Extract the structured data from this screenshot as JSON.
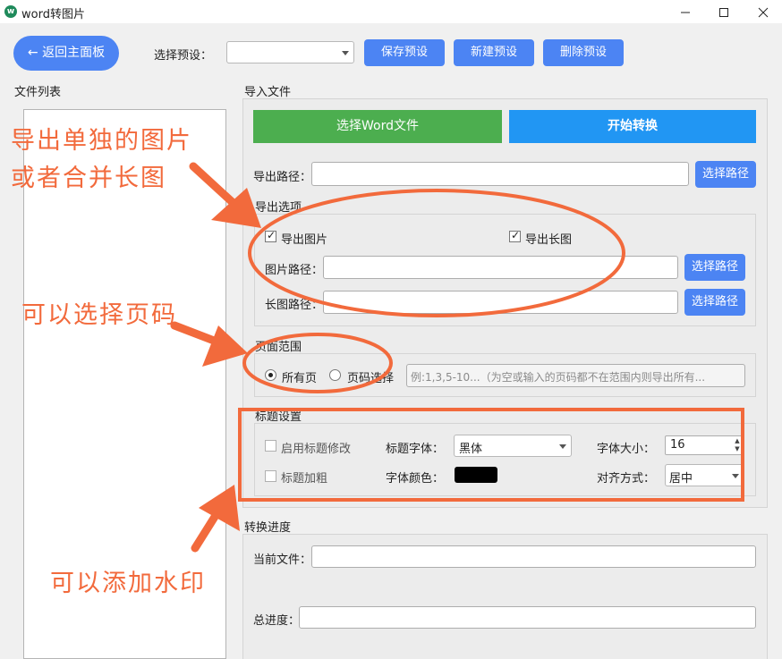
{
  "window": {
    "title": "word转图片",
    "icon": "app-logo-icon",
    "controls": [
      "minimize-icon",
      "maximize-icon",
      "close-icon"
    ]
  },
  "toolbar": {
    "back_label": "← 返回主面板",
    "preset_label": "选择预设：",
    "preset_value": "",
    "save_preset": "保存预设",
    "new_preset": "新建预设",
    "delete_preset": "删除预设"
  },
  "file_list": {
    "label": "文件列表"
  },
  "import": {
    "label": "导入文件",
    "select_word": "选择Word文件",
    "start": "开始转换",
    "export_path_label": "导出路径：",
    "export_path_value": "",
    "choose_path": "选择路径"
  },
  "export_options": {
    "label": "导出选项",
    "export_image": "导出图片",
    "export_image_checked": true,
    "export_long": "导出长图",
    "export_long_checked": true,
    "image_path_label": "图片路径：",
    "long_path_label": "长图路径：",
    "choose_path": "选择路径"
  },
  "page_range": {
    "label": "页面范围",
    "all_pages": "所有页",
    "select_pages": "页码选择",
    "selected": "all",
    "placeholder": "例:1,3,5-10...（为空或输入的页码都不在范围内则导出所有..."
  },
  "title_settings": {
    "label": "标题设置",
    "enable_edit": "启用标题修改",
    "bold": "标题加粗",
    "font_label": "标题字体：",
    "font_value": "黑体",
    "color_label": "字体颜色：",
    "color_value": "#000000",
    "size_label": "字体大小：",
    "size_value": "16",
    "align_label": "对齐方式：",
    "align_value": "居中"
  },
  "progress": {
    "label": "转换进度",
    "current_file_label": "当前文件：",
    "total_label": "总进度："
  },
  "annotations": {
    "export_note_line1": "导出单独的图片",
    "export_note_line2": "或者合并长图",
    "page_note": "可以选择页码",
    "watermark_note": "可以添加水印",
    "color": "#f26a3c"
  },
  "colors": {
    "accent_blue": "#4c84f3",
    "green": "#4cae4f",
    "cyan_blue": "#2196f3"
  }
}
